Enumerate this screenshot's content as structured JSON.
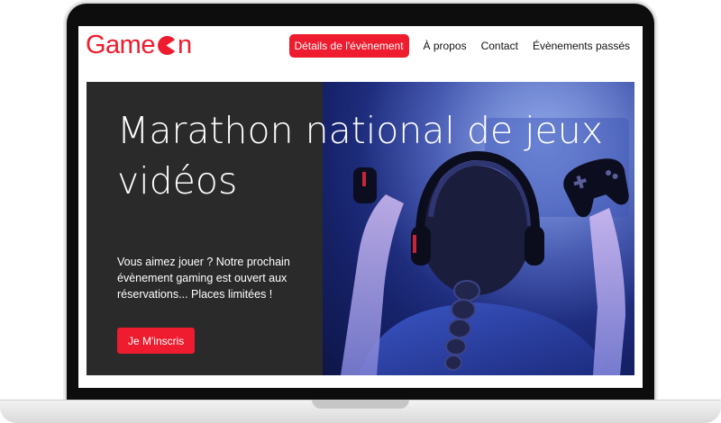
{
  "brand": {
    "name_start": "Game",
    "name_end": "n",
    "color": "#ee1c2e"
  },
  "nav": {
    "items": [
      {
        "label": "Détails de l'évènement",
        "active": true
      },
      {
        "label": "À propos",
        "active": false
      },
      {
        "label": "Contact",
        "active": false
      },
      {
        "label": "Évènements passés",
        "active": false
      }
    ]
  },
  "hero": {
    "title": "Marathon national de jeux vidéos",
    "description": "Vous aimez jouer ? Notre prochain évènement gaming est ouvert aux réservations... Places limitées !",
    "cta_label": "Je M'inscris",
    "image_subject": "girl-with-headphones-holding-game-controller"
  }
}
